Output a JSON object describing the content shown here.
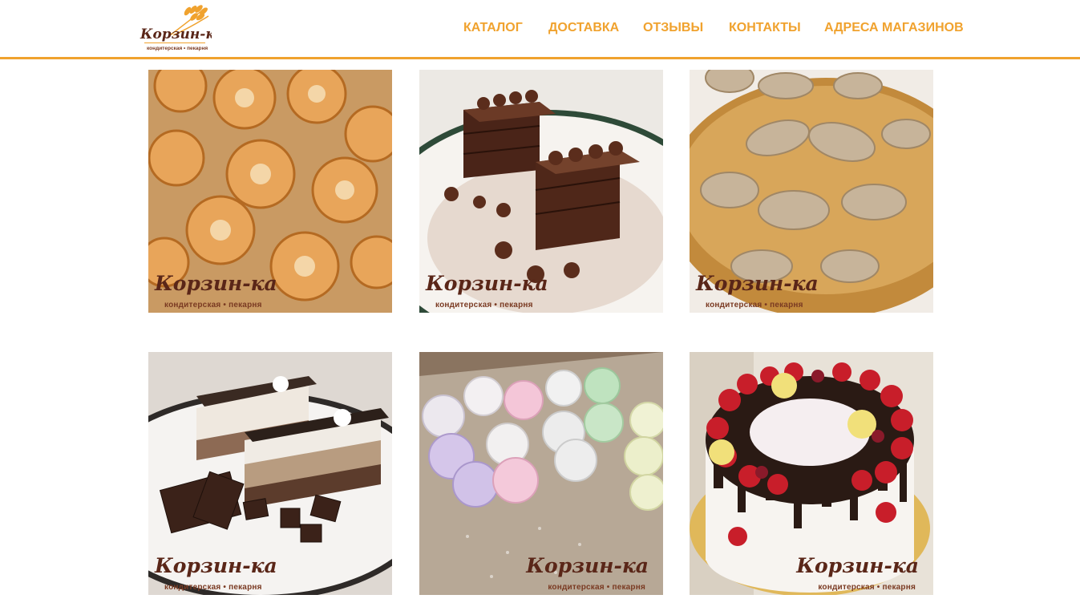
{
  "brand": {
    "logo_title": "Корзин-ка",
    "logo_subtitle": "кондитерская • пекарня"
  },
  "nav": {
    "items": [
      {
        "label": "КАТАЛОГ"
      },
      {
        "label": "ДОСТАВКА"
      },
      {
        "label": "ОТЗЫВЫ"
      },
      {
        "label": "КОНТАКТЫ"
      },
      {
        "label": "АДРЕСА МАГАЗИНОВ"
      }
    ]
  },
  "gallery": {
    "watermark_title": "Корзин-ка",
    "watermark_subtitle": "кондитерская • пекарня"
  },
  "colors": {
    "accent": "#f0a22e",
    "watermark": "#5a2618"
  }
}
